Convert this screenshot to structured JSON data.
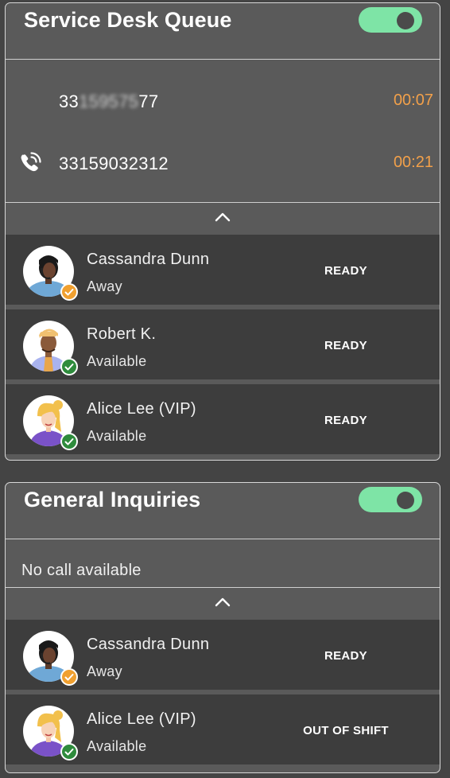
{
  "queues": [
    {
      "title": "Service Desk Queue",
      "enabled": true,
      "calls": [
        {
          "number_prefix": "33",
          "number_hidden": "159575",
          "number_suffix": "77",
          "timer": "00:07"
        },
        {
          "number": "33159032312",
          "timer": "00:21"
        }
      ],
      "agents": [
        {
          "name": "Cassandra Dunn",
          "presence": "Away",
          "status": "READY"
        },
        {
          "name": "Robert K.",
          "presence": "Available",
          "status": "READY"
        },
        {
          "name": "Alice Lee (VIP)",
          "presence": "Available",
          "status": "READY"
        }
      ]
    },
    {
      "title": "General Inquiries",
      "enabled": true,
      "no_call_text": "No call available",
      "agents": [
        {
          "name": "Cassandra Dunn",
          "presence": "Away",
          "status": "READY"
        },
        {
          "name": "Alice Lee (VIP)",
          "presence": "Available",
          "status": "OUT OF SHIFT"
        }
      ]
    }
  ],
  "colors": {
    "toggle_on": "#7ee4a6",
    "timer": "#f2a04a",
    "badge_away": "#f0a030",
    "badge_available": "#2e8b3c"
  },
  "icons": {
    "ringing_call": "phone-ringing-icon",
    "collapse": "chevron-up-icon",
    "badge": "check-badge-icon"
  }
}
